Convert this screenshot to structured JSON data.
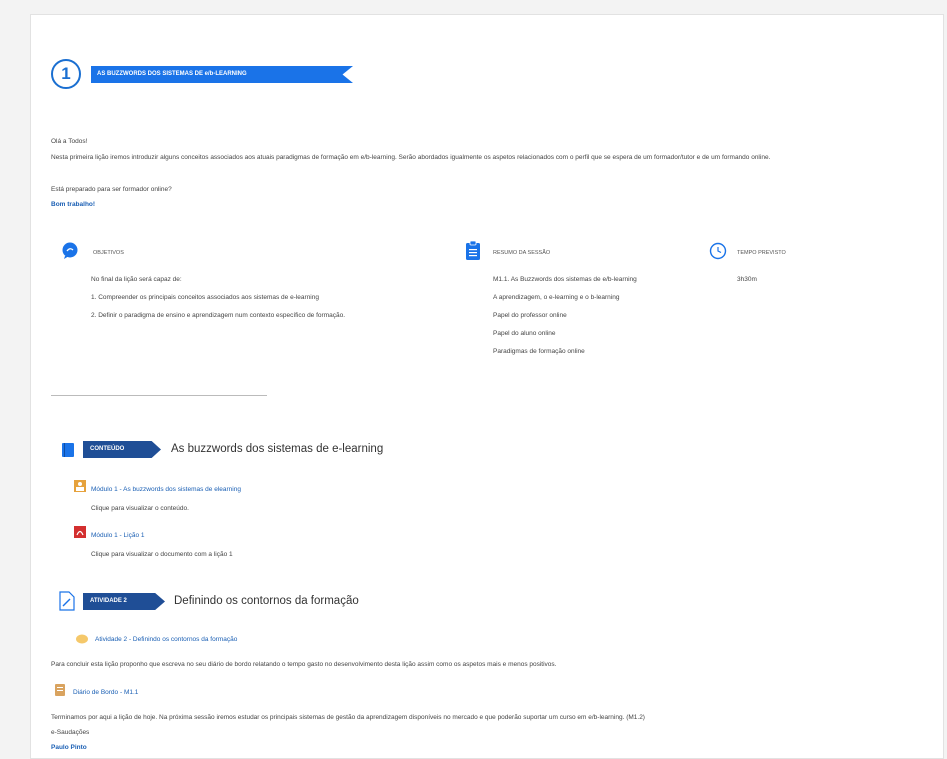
{
  "lesson": {
    "number": "1",
    "banner": "AS BUZZWORDS DOS SISTEMAS DE e/b-LEARNING",
    "greeting": "Olá a Todos!",
    "intro": "Nesta primeira lição iremos introduzir alguns conceitos associados aos atuais paradigmas de formação em e/b-learning. Serão abordados igualmente os aspetos relacionados com o perfil que se espera de um formador/tutor e de um formando online.",
    "question": "Está preparado para ser formador online?",
    "sign_off": "Bom trabalho!"
  },
  "objectives": {
    "icon": "chat-bubble-icon",
    "label": "OBJETIVOS",
    "intro": "No final da lição será capaz de:",
    "items": [
      "1. Compreender os principais conceitos associados aos sistemas de e-learning",
      "2. Definir o paradigma de ensino e aprendizagem num contexto específico de formação."
    ]
  },
  "summary": {
    "icon": "clipboard-icon",
    "label": "RESUMO DA SESSÃO",
    "items": [
      "M1.1. As Buzzwords dos sistemas de e/b-learning",
      "A aprendizagem, o e-learning e o b-learning",
      "Papel do professor online",
      "Papel do aluno online",
      "Paradigmas de formação online"
    ]
  },
  "time": {
    "icon": "clock-icon",
    "label": "TEMPO PREVISTO",
    "value": "3h30m"
  },
  "contents": {
    "tag": "CONTEÚDO",
    "title": "As buzzwords dos sistemas de e-learning",
    "items": [
      {
        "icon": "module-icon",
        "link": "Módulo 1 - As buzzwords dos sistemas de elearning",
        "desc": "Clique para visualizar o conteúdo."
      },
      {
        "icon": "pdf-icon",
        "link": "Módulo 1 - Lição 1",
        "desc": "Clique para visualizar o documento com a lição 1"
      }
    ]
  },
  "activity": {
    "tag": "ATIVIDADE 2",
    "title": "Definindo os contornos da formação",
    "link": "Atividade 2 - Definindo os contornos da formação",
    "text": "Para concluir esta lição proponho que escreva no seu diário de bordo relatando o tempo gasto no desenvolvimento desta lição assim como os aspetos mais e menos positivos.",
    "diary_link": "Diário de Bordo - M1.1",
    "closing": "Terminamos por aqui a lição de hoje. Na próxima sessão iremos estudar os principais sistemas de gestão da aprendizagem disponíveis no mercado e que poderão suportar um curso em e/b-learning. (M1.2)",
    "regards": "e-Saudações",
    "author": "Paulo Pinto"
  },
  "colors": {
    "accent": "#1a73e8",
    "tag": "#1f4e96",
    "link": "#1a5fb4"
  }
}
